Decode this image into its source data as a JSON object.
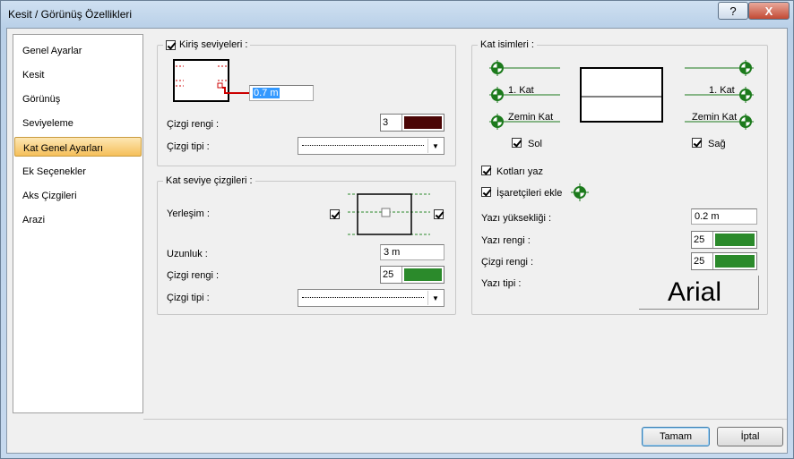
{
  "window": {
    "title": "Kesit / Görünüş Özellikleri",
    "help": "?",
    "close": "X"
  },
  "nav": {
    "items": [
      "Genel Ayarlar",
      "Kesit",
      "Görünüş",
      "Seviyeleme",
      "Kat Genel Ayarları",
      "Ek Seçenekler",
      "Aks Çizgileri",
      "Arazi"
    ],
    "selected": "Kat Genel Ayarları"
  },
  "beam": {
    "title": "Kiriş seviyeleri :",
    "checked": true,
    "offset": "0.7 m",
    "color_label": "Çizgi rengi :",
    "color_num": "3",
    "color": "#4a0505",
    "type_label": "Çizgi tipi :"
  },
  "level": {
    "title": "Kat seviye çizgileri :",
    "placement_label": "Yerleşim :",
    "left_checked": true,
    "right_checked": true,
    "length_label": "Uzunluk :",
    "length": "3 m",
    "color_label": "Çizgi rengi :",
    "color_num": "25",
    "color": "#2b8a2b",
    "type_label": "Çizgi tipi :"
  },
  "names": {
    "title": "Kat isimleri :",
    "left_label1": "1. Kat",
    "left_label2": "Zemin Kat",
    "right_label1": "1. Kat",
    "right_label2": "Zemin Kat",
    "sol": "Sol",
    "sag": "Sağ",
    "kotlari": "Kotları yaz",
    "isaret": "İşaretçileri ekle",
    "height_label": "Yazı yüksekliği :",
    "height": "0.2 m",
    "text_color_label": "Yazı rengi :",
    "text_color_num": "25",
    "line_color_label": "Çizgi rengi :",
    "line_color_num": "25",
    "green": "#2b8a2b",
    "font_label": "Yazı tipi :",
    "font_preview": "Arial"
  },
  "buttons": {
    "ok": "Tamam",
    "cancel": "İptal"
  }
}
